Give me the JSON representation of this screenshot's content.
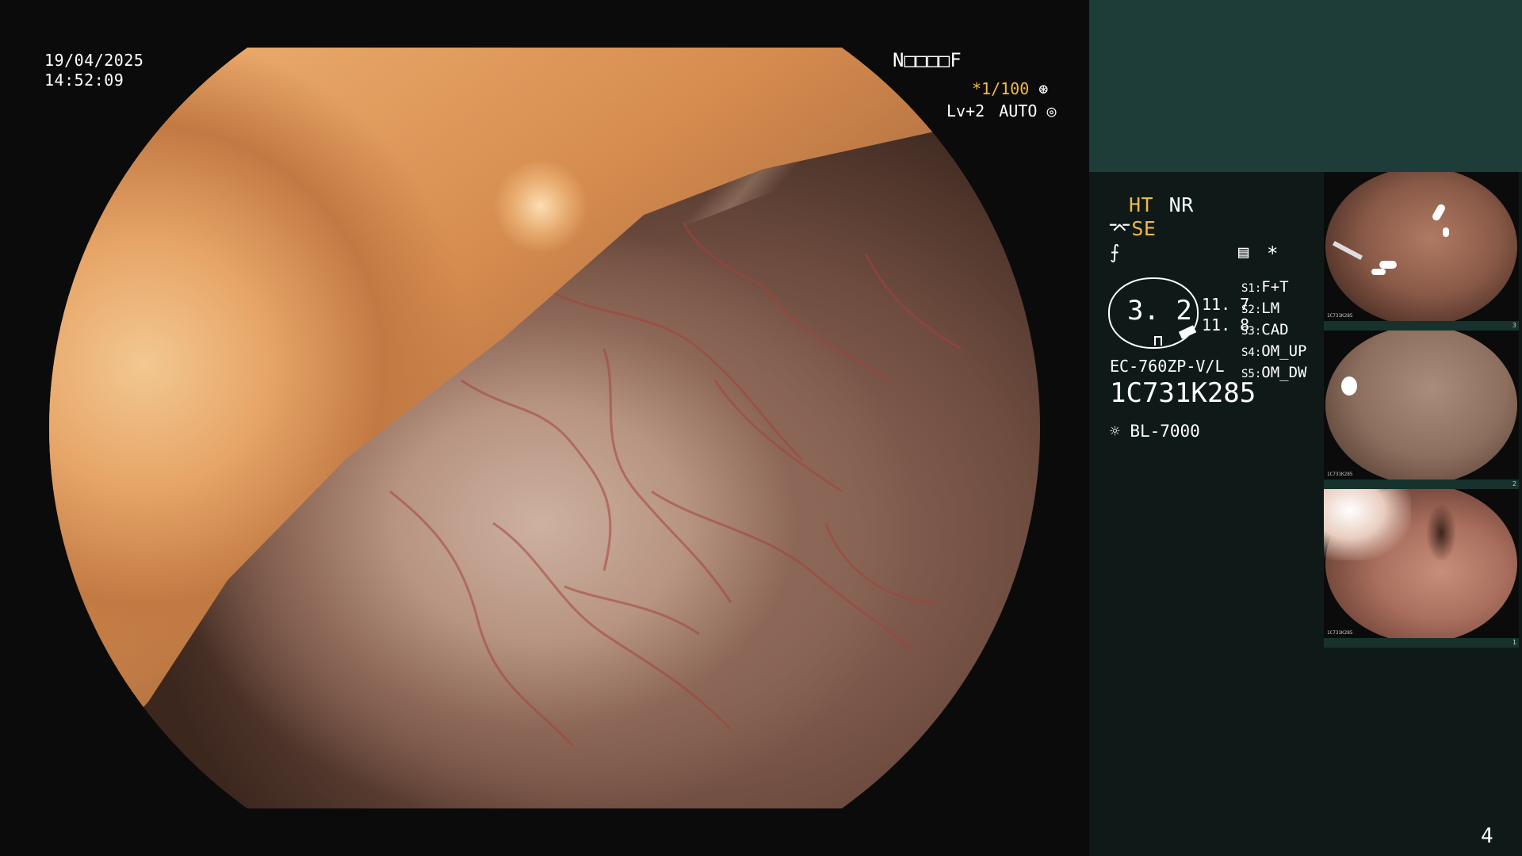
{
  "overlay": {
    "date": "19/04/2025",
    "time": "14:52:09",
    "patient_code": "N□□□□F",
    "shutter": "*1/100",
    "level": "Lv+2",
    "mode": "AUTO"
  },
  "settings": {
    "ht": "HT",
    "nr": "NR",
    "se": "SE",
    "star": "*",
    "zoom": "3. 2",
    "value_top": "11. 7",
    "value_bottom": "11. 8",
    "scope_model": "EC-760ZP-V/L",
    "scope_serial": "1C731K285",
    "light_source": "BL-7000"
  },
  "switches": [
    {
      "key": "S1:",
      "value": "F+T"
    },
    {
      "key": "S2:",
      "value": "LM"
    },
    {
      "key": "S3:",
      "value": "CAD"
    },
    {
      "key": "S4:",
      "value": "OM_UP"
    },
    {
      "key": "S5:",
      "value": "OM_DW"
    }
  ],
  "thumbnails": [
    {
      "index": "3",
      "serial": "1C731K285"
    },
    {
      "index": "2",
      "serial": "1C731K285"
    },
    {
      "index": "1",
      "serial": "1C731K285"
    }
  ],
  "page_number": "4",
  "colors": {
    "accent": "#f2b84a",
    "panel": "#0f1a18",
    "panel_top": "#1f3d38"
  }
}
